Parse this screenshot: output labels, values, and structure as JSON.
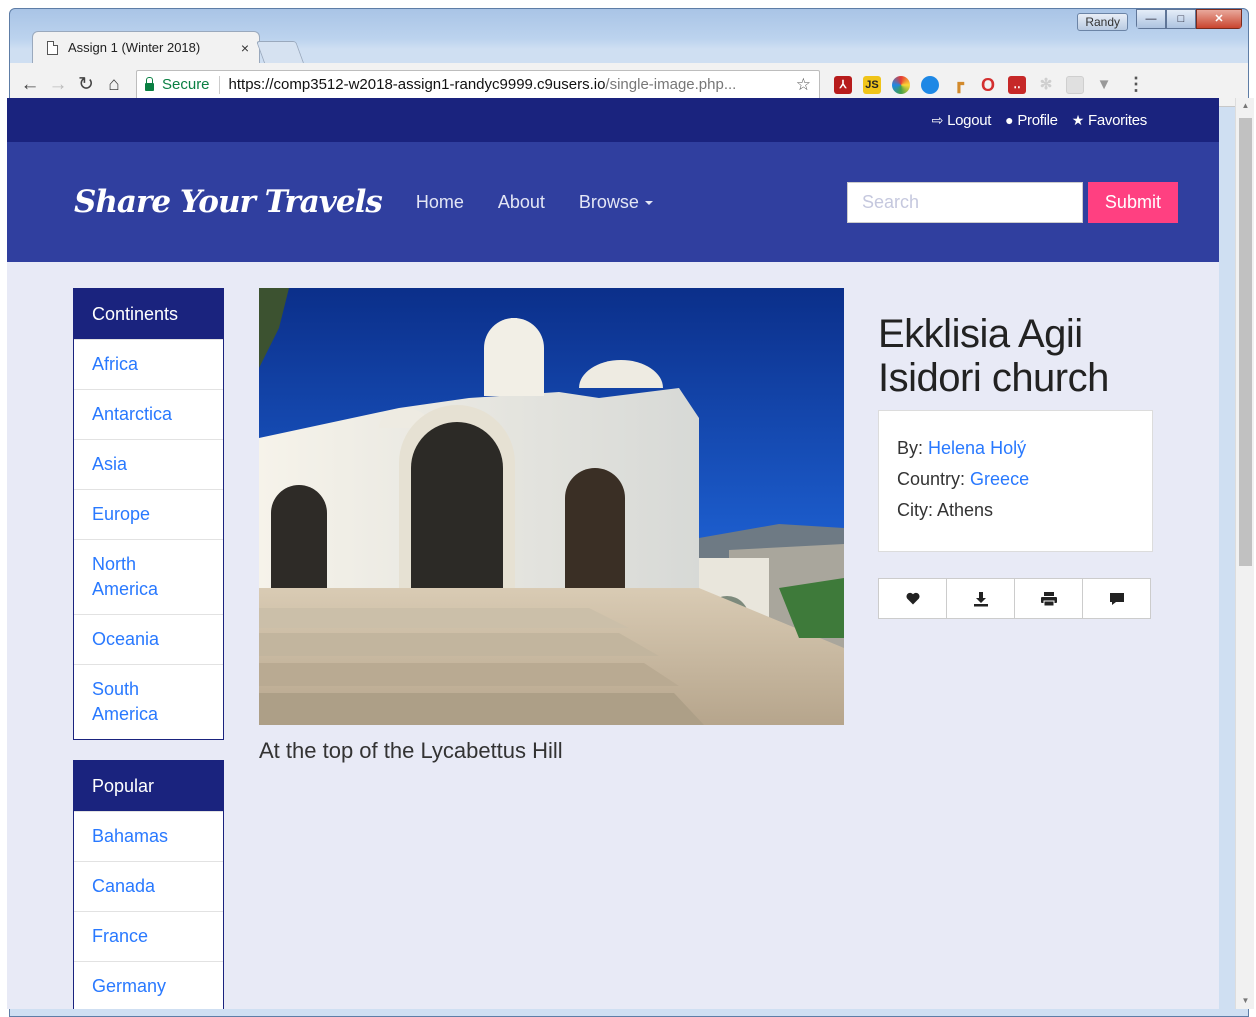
{
  "browser": {
    "tab_title": "Assign 1 (Winter 2018)",
    "tab_close": "×",
    "user_badge": "Randy",
    "minimize": "—",
    "maximize": "□",
    "close": "✕",
    "secure_label": "Secure",
    "url_host": "https://comp3512-w2018-assign1-randyc9999.c9users.io",
    "url_path": "/single-image.php...",
    "extension_icons": [
      "acrobat-icon",
      "js-icon",
      "color-picker-icon",
      "share-icon",
      "pipe-icon",
      "opera-icon",
      "lastpass-icon",
      "react-icon",
      "frame-icon",
      "vue-icon"
    ]
  },
  "topbar": {
    "logout": "Logout",
    "profile": "Profile",
    "favorites": "Favorites"
  },
  "nav": {
    "brand": "Share Your Travels",
    "home": "Home",
    "about": "About",
    "browse": "Browse",
    "search_placeholder": "Search",
    "submit": "Submit"
  },
  "continents": {
    "heading": "Continents",
    "items": [
      "Africa",
      "Antarctica",
      "Asia",
      "Europe",
      "North America",
      "Oceania",
      "South America"
    ]
  },
  "popular": {
    "heading": "Popular",
    "items": [
      "Bahamas",
      "Canada",
      "France",
      "Germany"
    ]
  },
  "image": {
    "title": "Ekklisia Agii Isidori church",
    "caption": "At the top of the Lycabettus Hill",
    "by_label": "By:",
    "author": "Helena Holý",
    "country_label": "Country:",
    "country": "Greece",
    "city_label": "City:",
    "city": "Athens"
  },
  "colors": {
    "topbar_bg": "#1a237e",
    "nav_bg": "#303f9f",
    "page_bg": "#e8eaf6",
    "link": "#2979ff",
    "accent": "#ff4081"
  }
}
